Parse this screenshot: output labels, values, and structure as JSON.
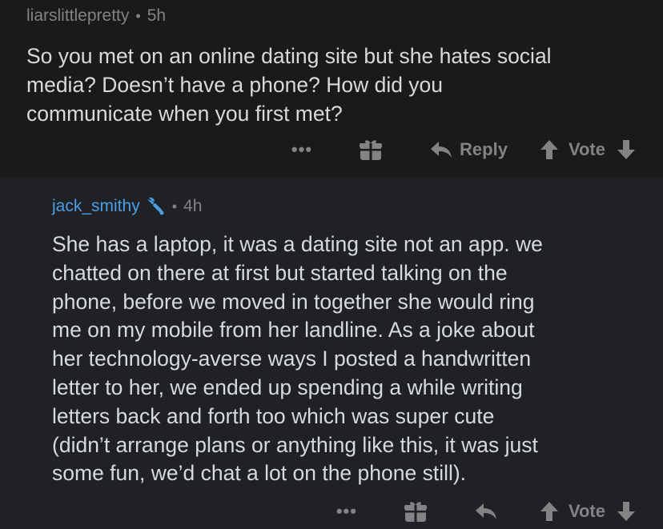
{
  "parent_comment": {
    "username": "liarslittlepretty",
    "separator": "•",
    "time": "5h",
    "body": "So you met on an online dating site but she hates social\nmedia? Doesn’t have a phone? How did you\ncommunicate when you first met?",
    "actions": {
      "more": "•••",
      "reply_label": "Reply",
      "vote_label": "Vote"
    }
  },
  "reply_comment": {
    "username": "jack_smithy",
    "separator": "•",
    "time": "4h",
    "body": "She has a laptop, it was a dating site not an app. we\nchatted on there at first but started talking on the\nphone, before we moved in together she would ring\nme on my mobile from her landline. As a joke about\nher technology-averse ways I posted a handwritten\nletter to her, we ended up spending a while writing\nletters back and forth too which was super cute\n(didn’t arrange plans or anything like this, it was just\nsome fun, we’d chat a lot on the phone still).",
    "actions": {
      "more": "•••",
      "vote_label": "Vote"
    }
  },
  "icons": {
    "gift": "gift-icon",
    "reply": "reply-arrow-icon",
    "upvote": "upvote-arrow-icon",
    "downvote": "downvote-arrow-icon",
    "mod": "mod-wrench-icon"
  },
  "colors": {
    "background_top": "#1a1a1b",
    "background_reply": "#1f2125",
    "text": "#d7dadc",
    "muted": "#818384",
    "username_accent": "#4a9fe8"
  }
}
